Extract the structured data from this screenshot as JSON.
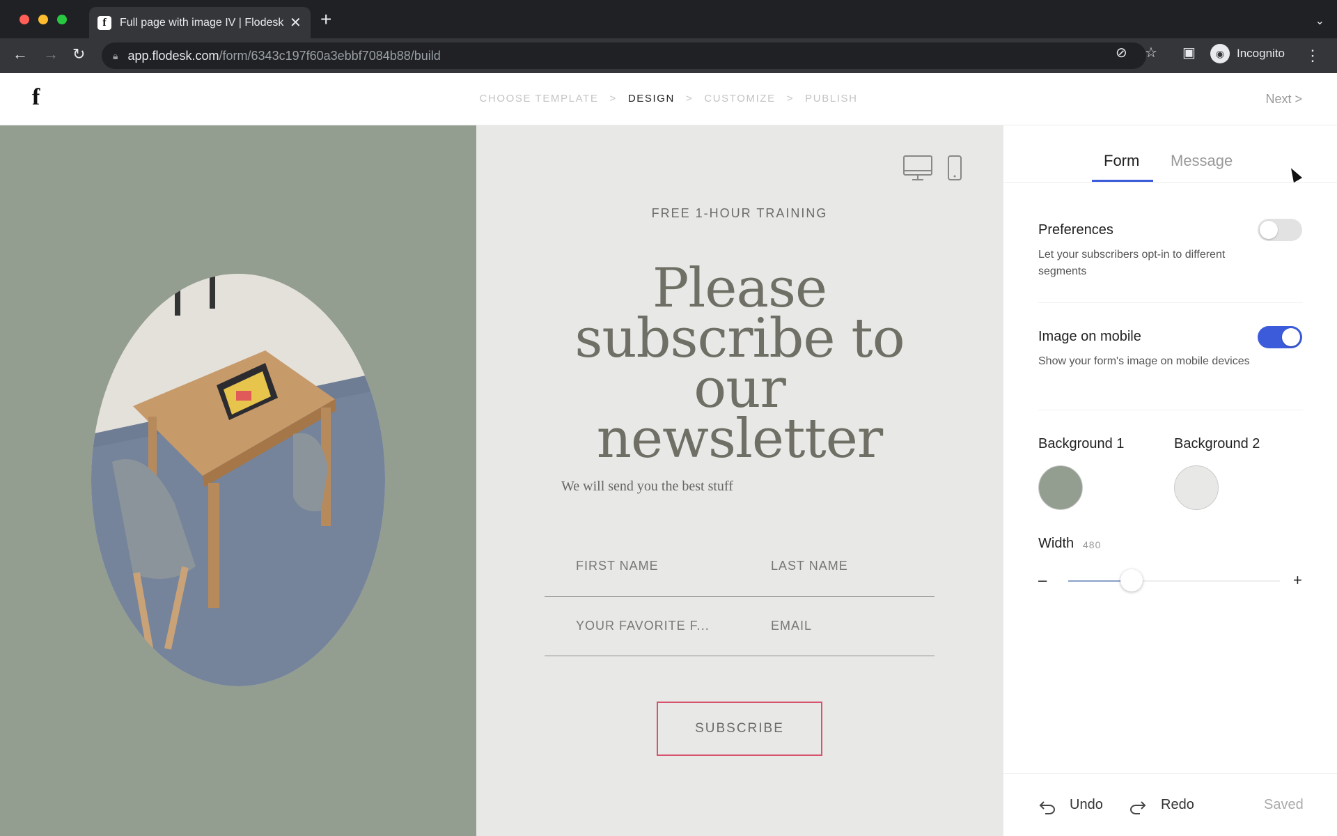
{
  "browser": {
    "tab_title": "Full page with image IV | Flodesk",
    "tab_favicon": "f",
    "url_host": "app.flodesk.com",
    "url_path": "/form/6343c197f60a3ebbf7084b88/build",
    "profile_label": "Incognito",
    "icons": [
      "back-icon",
      "forward-icon",
      "reload-icon",
      "lock-icon",
      "eye-off-icon",
      "star-icon",
      "sidepanel-icon",
      "incognito-icon",
      "kebab-menu-icon"
    ]
  },
  "header": {
    "logo": "f",
    "steps": [
      "CHOOSE TEMPLATE",
      "DESIGN",
      "CUSTOMIZE",
      "PUBLISH"
    ],
    "step_separator": ">",
    "active_step": 1,
    "next_label": "Next  >"
  },
  "form": {
    "eyebrow": "FREE 1-HOUR TRAINING",
    "headline_lines": [
      "Please",
      "subscribe to our",
      "newsletter"
    ],
    "subtext": "We will send you the best stuff",
    "fields": [
      "FIRST NAME",
      "LAST NAME",
      "YOUR FAVORITE F...",
      "EMAIL"
    ],
    "subscribe_label": "SUBSCRIBE",
    "accent_color": "#d6546e"
  },
  "settings": {
    "tabs": [
      "Form",
      "Message"
    ],
    "active_tab": 0,
    "preferences": {
      "title": "Preferences",
      "desc": "Let your subscribers opt-in to different segments",
      "enabled": false
    },
    "image_on_mobile": {
      "title": "Image on mobile",
      "desc": "Show your form's image on mobile devices",
      "enabled": true
    },
    "background1": {
      "label": "Background 1",
      "color": "#939e90"
    },
    "background2": {
      "label": "Background 2",
      "color": "#e8e8e6"
    },
    "width": {
      "label": "Width",
      "value": "480",
      "minus": "–",
      "plus": "+",
      "fraction": 0.3
    },
    "toggle_color": "#3b5bdb"
  },
  "footer": {
    "undo_label": "Undo",
    "redo_label": "Redo",
    "status": "Saved"
  }
}
